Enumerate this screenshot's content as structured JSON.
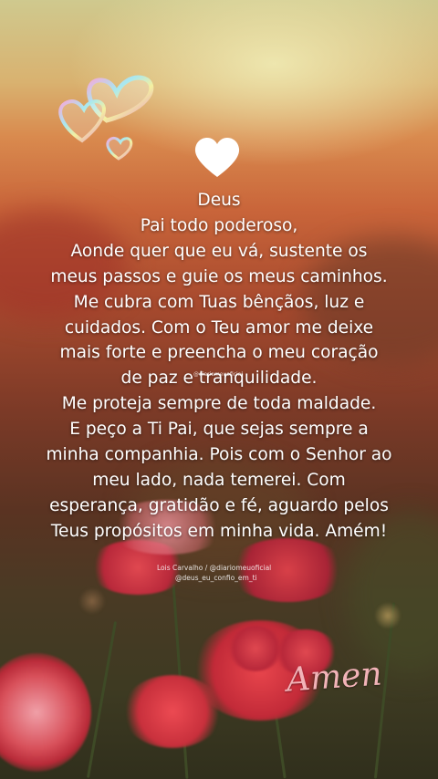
{
  "prayer": {
    "lines": [
      "Deus",
      "Pai todo poderoso,",
      "Aonde quer que eu vá, sustente os",
      "meus passos e guie os meus caminhos.",
      "Me cubra com Tuas bênçãos, luz e",
      "cuidados. Com o Teu amor me deixe",
      "mais forte e preencha o meu coração",
      "de paz e tranquilidade.",
      "Me proteja sempre de toda maldade.",
      "E peço a Ti Pai, que sejas sempre a",
      "minha companhia. Pois com o Senhor ao",
      "meu lado, nada temerei. Com",
      "esperança, gratidão e fé, aguardo pelos",
      "Teus propósitos em minha vida. Amém!"
    ]
  },
  "watermark_mid": "@diariomeuoficial",
  "credits": {
    "line1": "Lois Carvalho / @diariomeuoficial",
    "line2": "@deus_eu_confio_em_ti"
  },
  "amen": "Amen",
  "icons": {
    "decorative_hearts": "iridescent-hearts-icon",
    "top_heart": "white-heart-icon"
  },
  "colors": {
    "text": "#ffffff",
    "amen": "#f2b3b8",
    "flowers": "#c8303c"
  }
}
